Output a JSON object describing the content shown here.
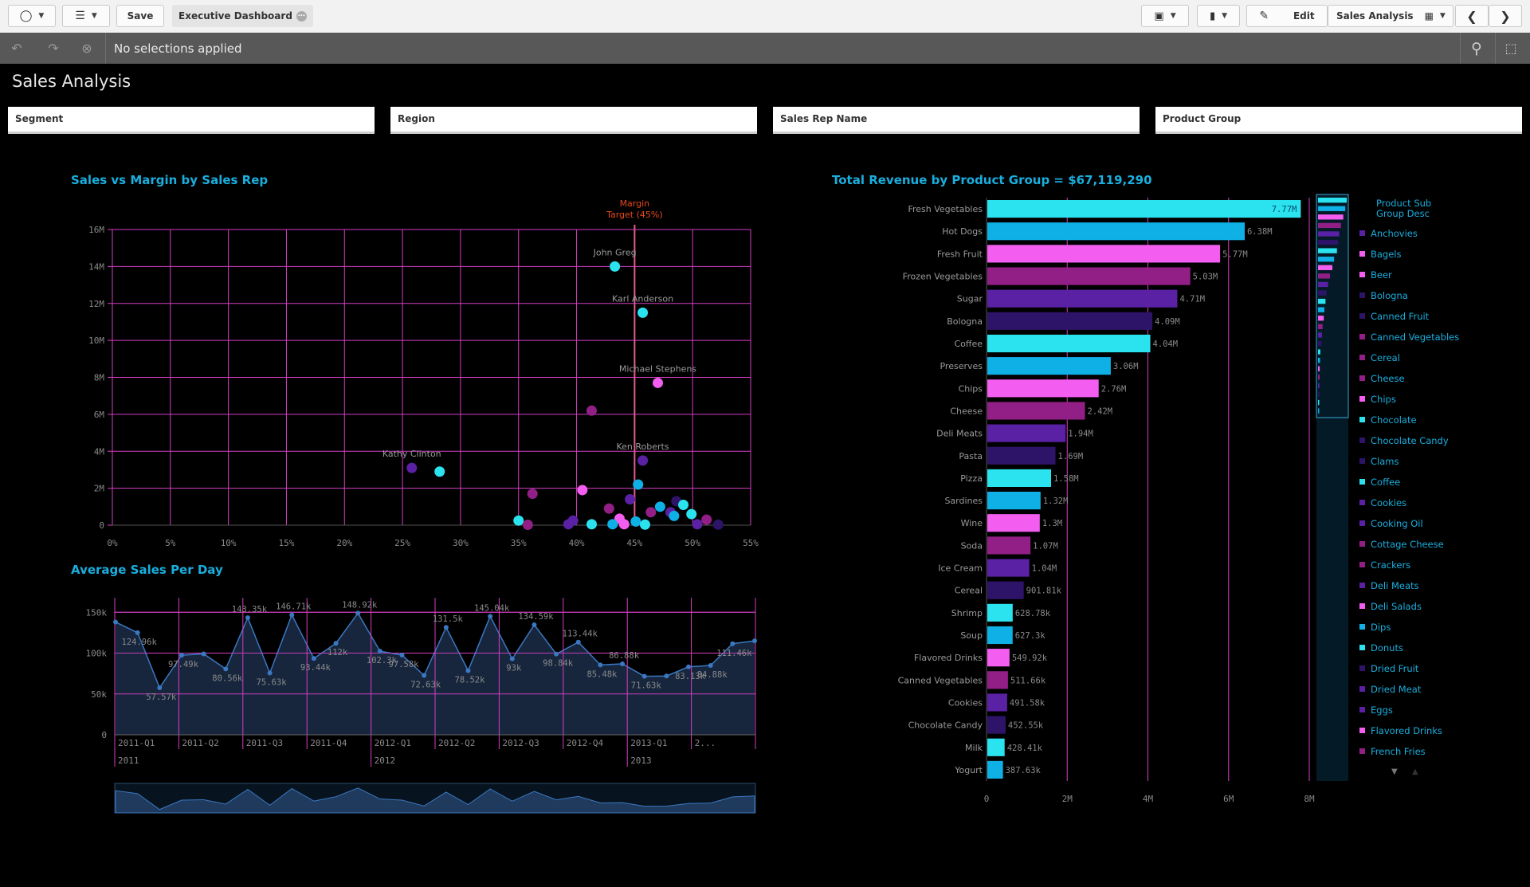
{
  "toolbar": {
    "nav_icon": "compass-icon",
    "list_icon": "list-icon",
    "save_label": "Save",
    "app_title": "Executive Dashboard",
    "present_icon": "presentation-icon",
    "bookmark_icon": "bookmark-icon",
    "edit_label": "Edit",
    "sheet_label": "Sales Analysis",
    "sheet_icon": "sheet-icon",
    "prev_icon": "chevron-left-icon",
    "next_icon": "chevron-right-icon"
  },
  "selection_bar": {
    "message": "No selections applied",
    "icons": [
      "step-back-icon",
      "step-forward-icon",
      "clear-selections-icon",
      "search-icon",
      "selection-tool-icon"
    ]
  },
  "sheet_title": "Sales Analysis",
  "filters": [
    "Segment",
    "Region",
    "Sales Rep Name",
    "Product Group"
  ],
  "colors": {
    "background": "#000000",
    "title": "#1aaede",
    "grid": "#d53ec4",
    "reference_line": "#e35b8d",
    "palette": [
      "#2ae3ef",
      "#0fb0e6",
      "#f45ef0",
      "#921f86",
      "#5a21a4",
      "#2d1468"
    ]
  },
  "scatter": {
    "title": "Sales vs Margin by Sales Rep",
    "reference_label": [
      "Margin",
      "Target (45%)"
    ],
    "chart_data": {
      "type": "scatter",
      "xlabel": "",
      "ylabel": "",
      "xlim": [
        0,
        55
      ],
      "ylim": [
        0,
        16000000
      ],
      "x_ticks": [
        "0%",
        "5%",
        "10%",
        "15%",
        "20%",
        "25%",
        "30%",
        "35%",
        "40%",
        "45%",
        "50%",
        "55%"
      ],
      "y_ticks": [
        "0",
        "2M",
        "4M",
        "6M",
        "8M",
        "10M",
        "12M",
        "14M",
        "16M"
      ],
      "grid": true,
      "reference_line_x": 45,
      "points": [
        {
          "label": "John Greg",
          "x": 43.3,
          "y": 14000000,
          "color": 0
        },
        {
          "label": "Karl Anderson",
          "x": 45.7,
          "y": 11500000,
          "color": 0
        },
        {
          "label": "Michael Stephens",
          "x": 47,
          "y": 7700000,
          "color": 2
        },
        {
          "label": "",
          "x": 41.3,
          "y": 6200000,
          "color": 3
        },
        {
          "label": "Ken Roberts",
          "x": 45.7,
          "y": 3500000,
          "color": 4
        },
        {
          "label": "Kathy Clinton",
          "x": 25.8,
          "y": 3100000,
          "color": 4
        },
        {
          "label": "",
          "x": 28.2,
          "y": 2900000,
          "color": 0
        },
        {
          "label": "",
          "x": 45.3,
          "y": 2200000,
          "color": 1
        },
        {
          "label": "",
          "x": 40.5,
          "y": 1900000,
          "color": 2
        },
        {
          "label": "",
          "x": 36.2,
          "y": 1700000,
          "color": 3
        },
        {
          "label": "",
          "x": 44.6,
          "y": 1400000,
          "color": 4
        },
        {
          "label": "",
          "x": 48.6,
          "y": 1300000,
          "color": 5
        },
        {
          "label": "",
          "x": 47.2,
          "y": 1000000,
          "color": 1
        },
        {
          "label": "",
          "x": 49.2,
          "y": 1100000,
          "color": 0
        },
        {
          "label": "",
          "x": 48.1,
          "y": 700000,
          "color": 4
        },
        {
          "label": "",
          "x": 42.8,
          "y": 900000,
          "color": 3
        },
        {
          "label": "",
          "x": 46.4,
          "y": 700000,
          "color": 3
        },
        {
          "label": "",
          "x": 49.9,
          "y": 600000,
          "color": 0
        },
        {
          "label": "",
          "x": 48.4,
          "y": 500000,
          "color": 1
        },
        {
          "label": "",
          "x": 51.2,
          "y": 300000,
          "color": 3
        },
        {
          "label": "",
          "x": 35,
          "y": 250000,
          "color": 0
        },
        {
          "label": "",
          "x": 39.7,
          "y": 250000,
          "color": 4
        },
        {
          "label": "",
          "x": 45.1,
          "y": 200000,
          "color": 1
        },
        {
          "label": "",
          "x": 43.7,
          "y": 350000,
          "color": 2
        },
        {
          "label": "",
          "x": 39.3,
          "y": 50000,
          "color": 4
        },
        {
          "label": "",
          "x": 41.3,
          "y": 50000,
          "color": 0
        },
        {
          "label": "",
          "x": 43.1,
          "y": 50000,
          "color": 1
        },
        {
          "label": "",
          "x": 44.1,
          "y": 50000,
          "color": 2
        },
        {
          "label": "",
          "x": 45.9,
          "y": 30000,
          "color": 0
        },
        {
          "label": "",
          "x": 50.4,
          "y": 50000,
          "color": 4
        },
        {
          "label": "",
          "x": 52.2,
          "y": 30000,
          "color": 5
        },
        {
          "label": "",
          "x": 35.8,
          "y": 20000,
          "color": 3
        }
      ]
    }
  },
  "line": {
    "title": "Average Sales Per Day",
    "chart_data": {
      "type": "area",
      "ylim": [
        0,
        160000
      ],
      "y_ticks": [
        "0",
        "50k",
        "100k",
        "150k"
      ],
      "quarters": [
        "2011-Q1",
        "2011-Q2",
        "2011-Q3",
        "2011-Q4",
        "2012-Q1",
        "2012-Q2",
        "2012-Q3",
        "2012-Q4",
        "2013-Q1",
        "2..."
      ],
      "years": [
        "2011",
        "2012",
        "2013"
      ],
      "values": [
        138000,
        124960,
        57570,
        97490,
        99000,
        80560,
        143350,
        75630,
        146710,
        93440,
        112000,
        148920,
        102300,
        97580,
        72630,
        131500,
        78520,
        145040,
        93000,
        134590,
        98840,
        113440,
        85480,
        86880,
        71630,
        72000,
        83130,
        84880,
        111460,
        115000
      ],
      "labels": [
        "",
        "124.96k",
        "57.57k",
        "97.49k",
        "",
        "80.56k",
        "143.35k",
        "75.63k",
        "146.71k",
        "93.44k",
        "112k",
        "148.92k",
        "102.3k",
        "97.58k",
        "72.63k",
        "131.5k",
        "78.52k",
        "145.04k",
        "93k",
        "134.59k",
        "98.84k",
        "113.44k",
        "85.48k",
        "86.88k",
        "71.63k",
        "",
        "83.13k",
        "84.88k",
        "111.46k",
        ""
      ]
    }
  },
  "bar": {
    "title": "Total Revenue by Product Group = $67,119,290",
    "chart_data": {
      "type": "bar",
      "orientation": "horizontal",
      "xlim": [
        0,
        8000000
      ],
      "x_ticks": [
        "0",
        "2M",
        "4M",
        "6M",
        "8M"
      ],
      "categories": [
        "Fresh Vegetables",
        "Hot Dogs",
        "Fresh Fruit",
        "Frozen Vegetables",
        "Sugar",
        "Bologna",
        "Coffee",
        "Preserves",
        "Chips",
        "Cheese",
        "Deli Meats",
        "Pasta",
        "Pizza",
        "Sardines",
        "Wine",
        "Soda",
        "Ice Cream",
        "Cereal",
        "Shrimp",
        "Soup",
        "Flavored Drinks",
        "Canned Vegetables",
        "Cookies",
        "Chocolate Candy",
        "Milk",
        "Yogurt"
      ],
      "values": [
        7770000,
        6380000,
        5770000,
        5030000,
        4710000,
        4090000,
        4040000,
        3060000,
        2760000,
        2420000,
        1940000,
        1690000,
        1580000,
        1320000,
        1300000,
        1070000,
        1040000,
        901810,
        628780,
        627300,
        549920,
        511660,
        491580,
        452550,
        428410,
        387630
      ],
      "value_labels": [
        "7.77M",
        "6.38M",
        "5.77M",
        "5.03M",
        "4.71M",
        "4.09M",
        "4.04M",
        "3.06M",
        "2.76M",
        "2.42M",
        "1.94M",
        "1.69M",
        "1.58M",
        "1.32M",
        "1.3M",
        "1.07M",
        "1.04M",
        "901.81k",
        "628.78k",
        "627.3k",
        "549.92k",
        "511.66k",
        "491.58k",
        "452.55k",
        "428.41k",
        "387.63k"
      ],
      "colors": [
        0,
        1,
        2,
        3,
        4,
        5,
        0,
        1,
        2,
        3,
        4,
        5,
        0,
        1,
        2,
        3,
        4,
        5,
        0,
        1,
        2,
        3,
        4,
        5,
        0,
        1
      ]
    },
    "minimap_values": [
      1,
      0.95,
      0.88,
      0.8,
      0.74,
      0.7,
      0.66,
      0.56,
      0.5,
      0.42,
      0.35,
      0.3,
      0.26,
      0.22,
      0.2,
      0.16,
      0.14,
      0.12,
      0.08,
      0.07,
      0.06,
      0.06,
      0.05,
      0.05,
      0.04,
      0.04
    ]
  },
  "legend": {
    "title": [
      "Product Sub",
      "Group Desc"
    ],
    "items": [
      {
        "label": "Anchovies",
        "color": 4
      },
      {
        "label": "Bagels",
        "color": 2
      },
      {
        "label": "Beer",
        "color": 2
      },
      {
        "label": "Bologna",
        "color": 5
      },
      {
        "label": "Canned Fruit",
        "color": 5
      },
      {
        "label": "Canned Vegetables",
        "color": 3
      },
      {
        "label": "Cereal",
        "color": 3
      },
      {
        "label": "Cheese",
        "color": 3
      },
      {
        "label": "Chips",
        "color": 2
      },
      {
        "label": "Chocolate",
        "color": 0
      },
      {
        "label": "Chocolate Candy",
        "color": 5
      },
      {
        "label": "Clams",
        "color": 5
      },
      {
        "label": "Coffee",
        "color": 0
      },
      {
        "label": "Cookies",
        "color": 4
      },
      {
        "label": "Cooking Oil",
        "color": 4
      },
      {
        "label": "Cottage Cheese",
        "color": 3
      },
      {
        "label": "Crackers",
        "color": 3
      },
      {
        "label": "Deli Meats",
        "color": 4
      },
      {
        "label": "Deli Salads",
        "color": 2
      },
      {
        "label": "Dips",
        "color": 1
      },
      {
        "label": "Donuts",
        "color": 0
      },
      {
        "label": "Dried Fruit",
        "color": 5
      },
      {
        "label": "Dried Meat",
        "color": 4
      },
      {
        "label": "Eggs",
        "color": 4
      },
      {
        "label": "Flavored Drinks",
        "color": 2
      },
      {
        "label": "French Fries",
        "color": 3
      }
    ]
  }
}
